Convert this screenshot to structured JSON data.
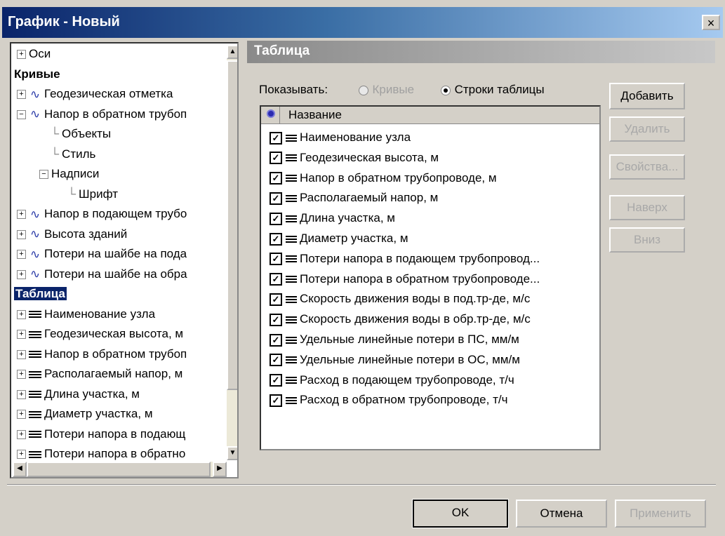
{
  "window": {
    "title": "График - Новый",
    "close": "×"
  },
  "tree": {
    "items": [
      {
        "label": "Оси",
        "kind": "node"
      },
      {
        "label": "Кривые",
        "kind": "heading"
      },
      {
        "label": "Геодезическая отметка",
        "kind": "curve"
      },
      {
        "label": "Напор в обратном трубоп",
        "kind": "curve"
      },
      {
        "label": "Объекты",
        "kind": "leaf"
      },
      {
        "label": "Стиль",
        "kind": "leaf"
      },
      {
        "label": "Надписи",
        "kind": "node"
      },
      {
        "label": "Шрифт",
        "kind": "leaf"
      },
      {
        "label": "Напор в подающем трубо",
        "kind": "curve"
      },
      {
        "label": "Высота зданий",
        "kind": "curve"
      },
      {
        "label": "Потери на шайбе на пода",
        "kind": "curve"
      },
      {
        "label": "Потери на шайбе на обра",
        "kind": "curve"
      },
      {
        "label": "Таблица",
        "kind": "heading-selected"
      },
      {
        "label": "Наименование узла",
        "kind": "row"
      },
      {
        "label": "Геодезическая высота, м",
        "kind": "row"
      },
      {
        "label": "Напор в обратном трубоп",
        "kind": "row"
      },
      {
        "label": "Располагаемый напор, м",
        "kind": "row"
      },
      {
        "label": "Длина участка, м",
        "kind": "row"
      },
      {
        "label": "Диаметр участка, м",
        "kind": "row"
      },
      {
        "label": "Потери напора в подающ",
        "kind": "row"
      },
      {
        "label": "Потери напора в обратно",
        "kind": "row"
      }
    ]
  },
  "panel": {
    "title": "Таблица",
    "show_label": "Показывать:",
    "radio_curves": "Кривые",
    "radio_rows": "Строки таблицы",
    "column_name": "Название",
    "rows": [
      "Наименование узла",
      "Геодезическая высота, м",
      "Напор в обратном трубопроводе, м",
      "Располагаемый напор, м",
      "Длина участка, м",
      "Диаметр участка, м",
      "Потери напора в подающем трубопровод...",
      "Потери напора в обратном трубопроводе...",
      "Скорость движения воды в под.тр-де, м/с",
      "Скорость движения воды в обр.тр-де, м/с",
      "Удельные линейные потери в ПС, мм/м",
      "Удельные линейные потери в ОС, мм/м",
      "Расход в подающем трубопроводе, т/ч",
      "Расход в обратном трубопроводе, т/ч"
    ]
  },
  "buttons": {
    "add": "Добавить",
    "delete": "Удалить",
    "properties": "Свойства...",
    "up": "Наверх",
    "down": "Вниз",
    "ok": "OK",
    "cancel": "Отмена",
    "apply": "Применить"
  },
  "colors": {
    "title_start": "#0a246a",
    "title_end": "#a6caf0",
    "selection": "#0a246a",
    "curve_icon": "#2a3aa8"
  }
}
